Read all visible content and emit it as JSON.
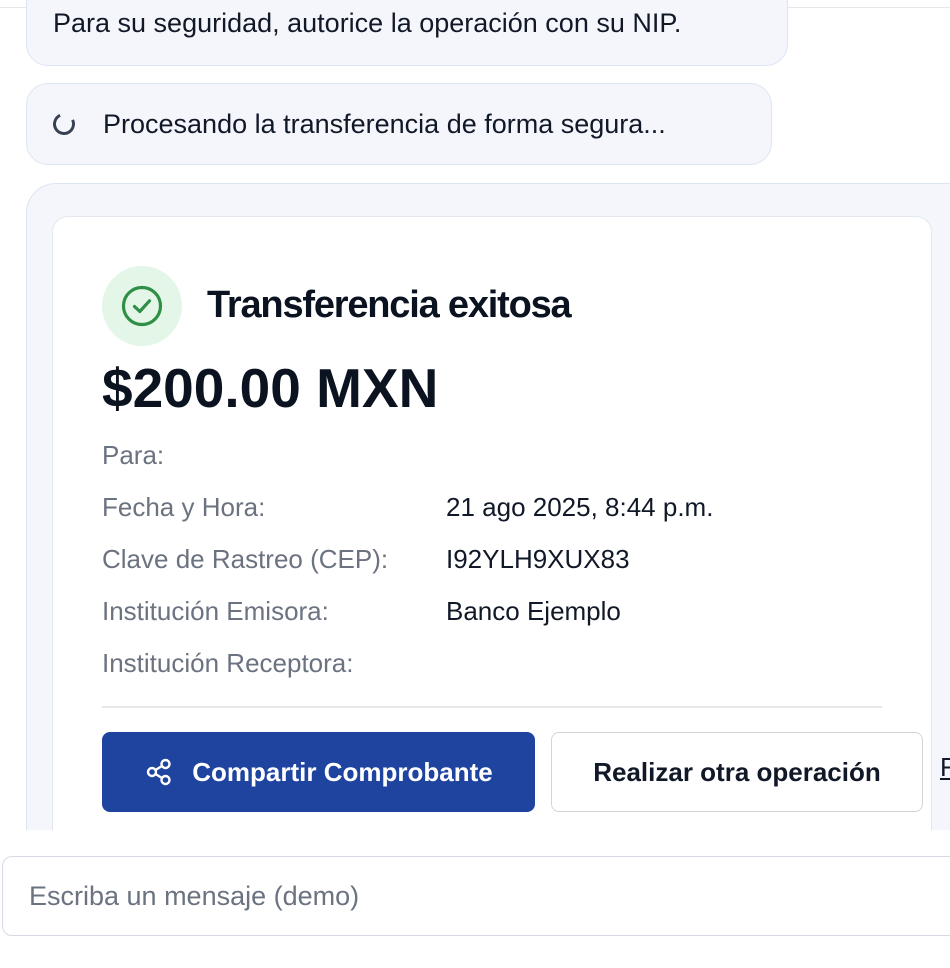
{
  "chat": {
    "nip_message": "Para su seguridad, autorice la operación con su NIP.",
    "processing_message": "Procesando la transferencia de forma segura..."
  },
  "receipt": {
    "status_title": "Transferencia exitosa",
    "amount": "$200.00 MXN",
    "details": [
      {
        "label": "Para:",
        "value": ""
      },
      {
        "label": "Fecha y Hora:",
        "value": "21 ago 2025, 8:44 p.m."
      },
      {
        "label": "Clave de Rastreo (CEP):",
        "value": "I92YLH9XUX83"
      },
      {
        "label": "Institución Emisora:",
        "value": "Banco Ejemplo"
      },
      {
        "label": "Institución Receptora:",
        "value": ""
      }
    ],
    "actions": {
      "share_label": "Compartir Comprobante",
      "another_label": "Realizar otra operación",
      "third_label": "F"
    },
    "icons": {
      "status": "check-circle-icon",
      "share": "share-icon",
      "spinner": "spinner-icon"
    },
    "colors": {
      "primary": "#1e44a0",
      "success": "#2f8f46",
      "success_bg": "#e3f6e7",
      "bubble_bg": "#f4f6fc"
    }
  },
  "composer": {
    "placeholder": "Escriba un mensaje (demo)"
  }
}
